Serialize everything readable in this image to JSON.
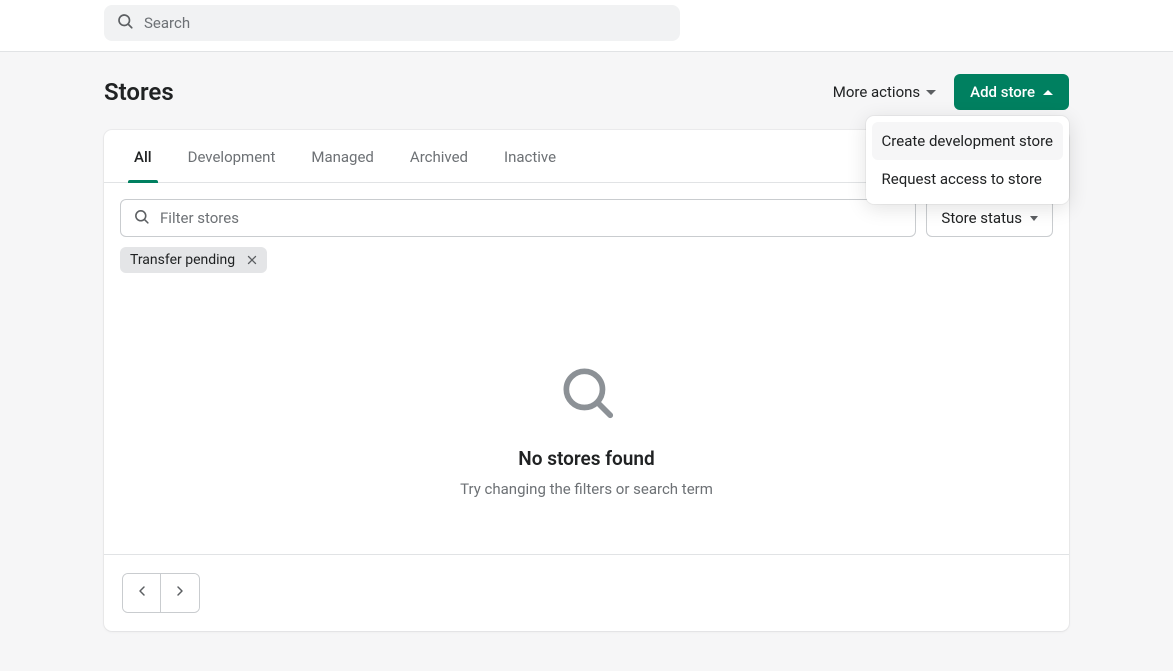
{
  "global_search": {
    "placeholder": "Search"
  },
  "page": {
    "title": "Stores",
    "more_actions_label": "More actions",
    "add_store_label": "Add store"
  },
  "add_store_menu": {
    "items": [
      {
        "label": "Create development store",
        "highlighted": true
      },
      {
        "label": "Request access to store",
        "highlighted": false
      }
    ]
  },
  "tabs": [
    {
      "label": "All",
      "active": true
    },
    {
      "label": "Development",
      "active": false
    },
    {
      "label": "Managed",
      "active": false
    },
    {
      "label": "Archived",
      "active": false
    },
    {
      "label": "Inactive",
      "active": false
    }
  ],
  "filters": {
    "search_placeholder": "Filter stores",
    "status_label": "Store status",
    "chips": [
      {
        "label": "Transfer pending"
      }
    ]
  },
  "empty": {
    "title": "No stores found",
    "subtitle": "Try changing the filters or search term"
  }
}
